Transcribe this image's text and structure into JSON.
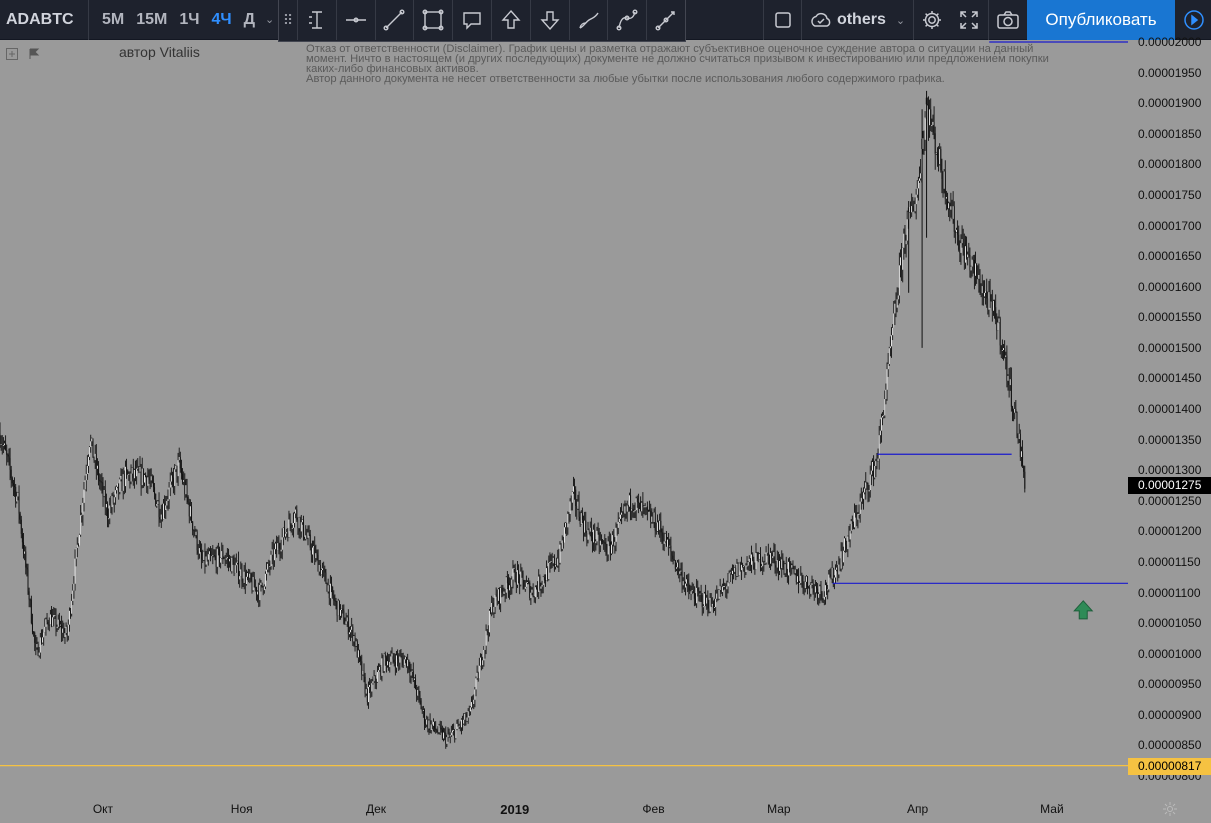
{
  "header": {
    "symbol": "ADABTC",
    "intervals": [
      {
        "label": "5M",
        "active": false
      },
      {
        "label": "15M",
        "active": false
      },
      {
        "label": "1Ч",
        "active": false
      },
      {
        "label": "4Ч",
        "active": true
      },
      {
        "label": "Д",
        "active": false
      }
    ],
    "drawing_tools": [
      "price-range-icon",
      "horizontal-line-icon",
      "trend-line-icon",
      "rectangle-icon",
      "callout-icon",
      "arrow-up-icon",
      "arrow-down-icon",
      "brush-icon",
      "path-icon",
      "ray-icon"
    ],
    "layout_name": "others",
    "publish_label": "Опубликовать"
  },
  "chart": {
    "author": "автор Vitaliis",
    "disclaimer": [
      "Отказ от ответственности (Disclaimer). График цены и разметка отражают субъективное оценочное суждение автора о ситуации на данный",
      "момент. Ничто в настоящем (и других последующих) документе не должно считаться призывом к инвестированию или предложением покупки",
      "каких-либо финансовых активов.",
      "Автор данного документа не несет ответственности за любые убытки после использования любого содержимого графика."
    ],
    "price_labels": [
      "0.00002000",
      "0.00001950",
      "0.00001900",
      "0.00001850",
      "0.00001800",
      "0.00001750",
      "0.00001700",
      "0.00001650",
      "0.00001600",
      "0.00001550",
      "0.00001500",
      "0.00001450",
      "0.00001400",
      "0.00001350",
      "0.00001300",
      "0.00001250",
      "0.00001200",
      "0.00001150",
      "0.00001100",
      "0.00001050",
      "0.00001000",
      "0.00000950",
      "0.00000900",
      "0.00000850",
      "0.00000800"
    ],
    "last_price": "0.00001275",
    "marked_price": "0.00000817",
    "time_labels": [
      "Окт",
      "Ноя",
      "Дек",
      "2019",
      "Фев",
      "Мар",
      "Апр",
      "Май"
    ],
    "colors": {
      "background": "#9a9a9a",
      "candles": "#111111",
      "level_lines": "#1a1acd",
      "marked_line": "#f5c242",
      "arrow": "#2e8b57"
    }
  },
  "chart_data": {
    "type": "candlestick",
    "ylim": [
      8e-06,
      2e-05
    ],
    "x_range": [
      "2018-09-08",
      "2019-05-18"
    ],
    "price_path": [
      [
        "2018-09-08",
        1.36e-05
      ],
      [
        "2018-09-12",
        1.25e-05
      ],
      [
        "2018-09-16",
        1e-05
      ],
      [
        "2018-09-19",
        1.06e-05
      ],
      [
        "2018-09-23",
        1.03e-05
      ],
      [
        "2018-09-28",
        1.35e-05
      ],
      [
        "2018-10-02",
        1.23e-05
      ],
      [
        "2018-10-06",
        1.29e-05
      ],
      [
        "2018-10-11",
        1.29e-05
      ],
      [
        "2018-10-14",
        1.23e-05
      ],
      [
        "2018-10-18",
        1.31e-05
      ],
      [
        "2018-10-23",
        1.15e-05
      ],
      [
        "2018-10-28",
        1.16e-05
      ],
      [
        "2018-11-05",
        1.1e-05
      ],
      [
        "2018-11-08",
        1.16e-05
      ],
      [
        "2018-11-13",
        1.23e-05
      ],
      [
        "2018-11-18",
        1.15e-05
      ],
      [
        "2018-11-22",
        1.08e-05
      ],
      [
        "2018-11-26",
        1.03e-05
      ],
      [
        "2018-11-29",
        9.3e-06
      ],
      [
        "2018-12-03",
        9.9e-06
      ],
      [
        "2018-12-08",
        9.9e-06
      ],
      [
        "2018-12-12",
        8.9e-06
      ],
      [
        "2018-12-17",
        8.6e-06
      ],
      [
        "2018-12-22",
        9e-06
      ],
      [
        "2018-12-27",
        1.08e-05
      ],
      [
        "2019-01-01",
        1.13e-05
      ],
      [
        "2019-01-05",
        1.1e-05
      ],
      [
        "2019-01-11",
        1.16e-05
      ],
      [
        "2019-01-14",
        1.26e-05
      ],
      [
        "2019-01-17",
        1.2e-05
      ],
      [
        "2019-01-22",
        1.17e-05
      ],
      [
        "2019-01-27",
        1.25e-05
      ],
      [
        "2019-02-02",
        1.21e-05
      ],
      [
        "2019-02-09",
        1.1e-05
      ],
      [
        "2019-02-14",
        1.08e-05
      ],
      [
        "2019-02-20",
        1.14e-05
      ],
      [
        "2019-02-27",
        1.16e-05
      ],
      [
        "2019-03-06",
        1.12e-05
      ],
      [
        "2019-03-11",
        1.1e-05
      ],
      [
        "2019-03-14",
        1.14e-05
      ],
      [
        "2019-03-19",
        1.24e-05
      ],
      [
        "2019-03-23",
        1.32e-05
      ],
      [
        "2019-03-26",
        1.5e-05
      ],
      [
        "2019-03-29",
        1.68e-05
      ],
      [
        "2019-04-01",
        1.76e-05
      ],
      [
        "2019-04-03",
        1.9e-05
      ],
      [
        "2019-04-06",
        1.8e-05
      ],
      [
        "2019-04-10",
        1.68e-05
      ],
      [
        "2019-04-14",
        1.62e-05
      ],
      [
        "2019-04-19",
        1.54e-05
      ],
      [
        "2019-04-23",
        1.38e-05
      ],
      [
        "2019-04-25",
        1.28e-05
      ]
    ],
    "levels": [
      {
        "price": 1.326e-05,
        "from": "2019-03-23",
        "to": "2019-04-22",
        "color": "#1a1acd"
      },
      {
        "price": 1.115e-05,
        "from": "2019-03-13",
        "to": "2019-05-18",
        "color": "#1a1acd"
      },
      {
        "price": 2e-05,
        "from": "2019-04-17",
        "to": "2019-05-18",
        "color": "#1a1acd"
      },
      {
        "price": 8.17e-06,
        "from": "2018-09-08",
        "to": "2019-05-18",
        "color": "#f5c242"
      }
    ],
    "arrow_up": {
      "date": "2019-05-08",
      "price": 1.07e-05
    },
    "last_price": 1.275e-05
  }
}
